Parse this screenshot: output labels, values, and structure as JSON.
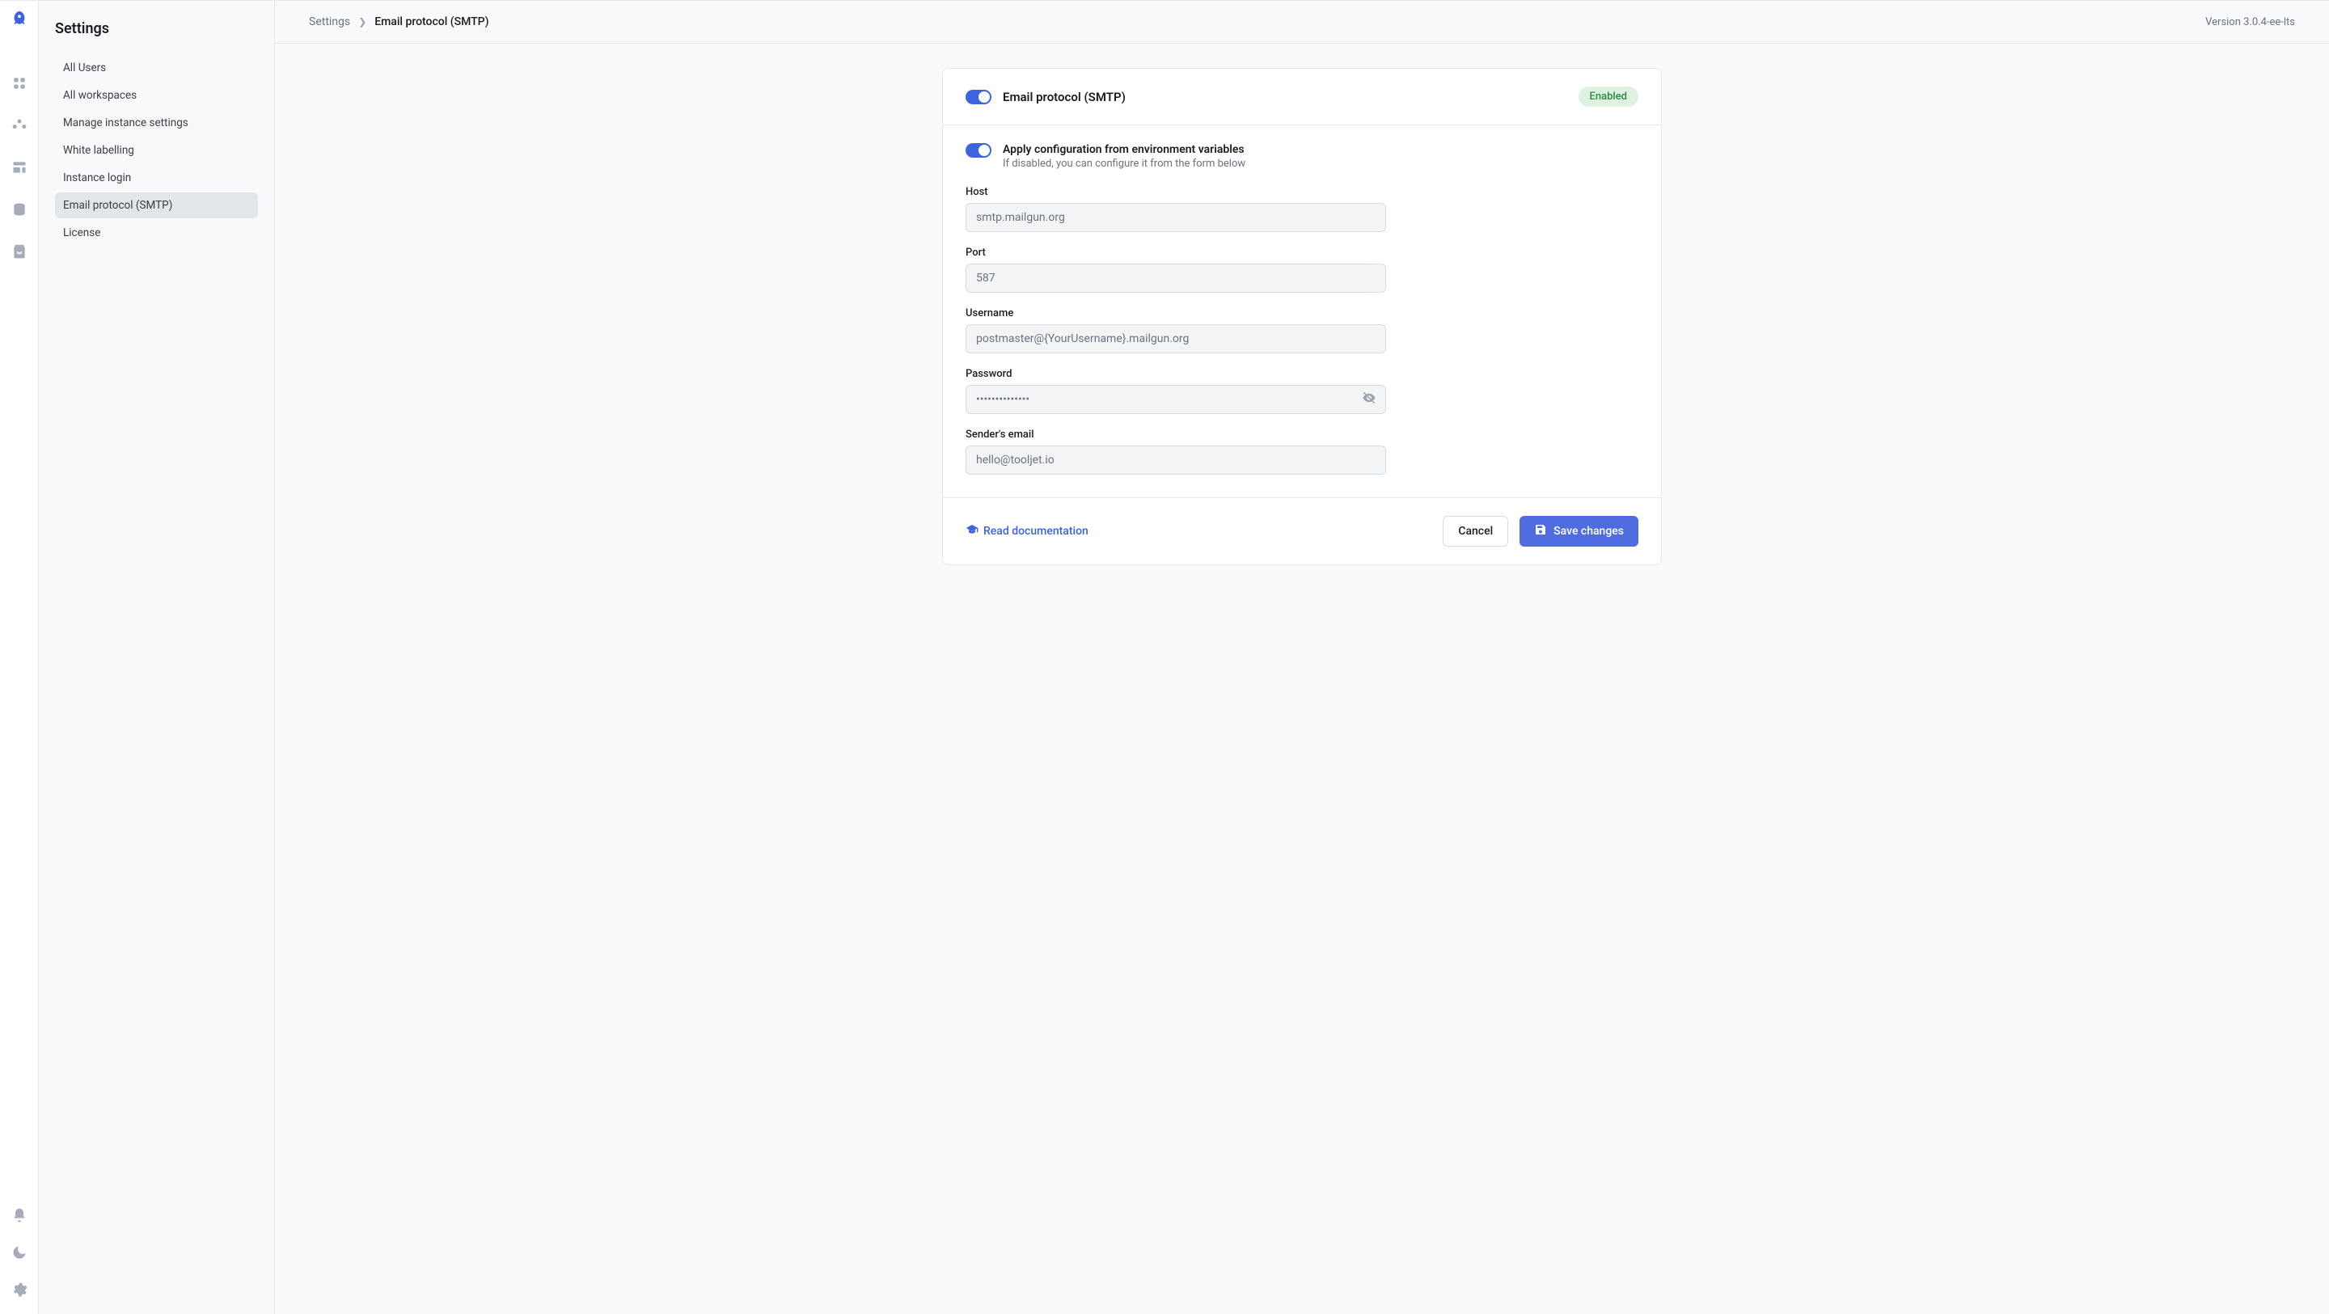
{
  "sidebar": {
    "title": "Settings",
    "items": [
      {
        "label": "All Users",
        "active": false
      },
      {
        "label": "All workspaces",
        "active": false
      },
      {
        "label": "Manage instance settings",
        "active": false
      },
      {
        "label": "White labelling",
        "active": false
      },
      {
        "label": "Instance login",
        "active": false
      },
      {
        "label": "Email protocol (SMTP)",
        "active": true
      },
      {
        "label": "License",
        "active": false
      }
    ]
  },
  "breadcrumb": {
    "root": "Settings",
    "current": "Email protocol (SMTP)"
  },
  "version": "Version 3.0.4-ee-lts",
  "card": {
    "title": "Email protocol (SMTP)",
    "badge": "Enabled",
    "config_title": "Apply configuration from environment variables",
    "config_sub": "If disabled, you can configure it from the form below",
    "fields": {
      "host_label": "Host",
      "host_value": "smtp.mailgun.org",
      "port_label": "Port",
      "port_value": "587",
      "username_label": "Username",
      "username_value": "postmaster@{YourUsername}.mailgun.org",
      "password_label": "Password",
      "password_value": "••••••••••••••",
      "sender_label": "Sender's email",
      "sender_value": "hello@tooljet.io"
    },
    "footer": {
      "doc": "Read documentation",
      "cancel": "Cancel",
      "save": "Save changes"
    }
  }
}
